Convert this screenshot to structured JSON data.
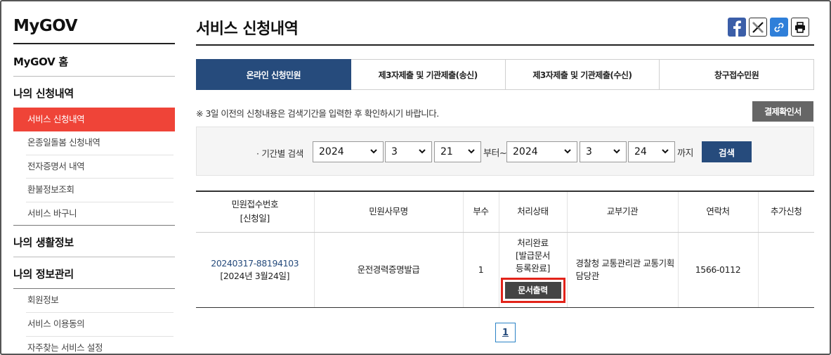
{
  "sidebar": {
    "brand": "MyGOV",
    "home": "MyGOV 홈",
    "section1": "나의 신청내역",
    "section1_items": [
      "서비스 신청내역",
      "온종일돌봄 신청내역",
      "전자증명서 내역",
      "환불정보조회",
      "서비스 바구니"
    ],
    "section2": "나의 생활정보",
    "section3": "나의 정보관리",
    "section3_items": [
      "회원정보",
      "서비스 이용동의",
      "자주찾는 서비스 설정"
    ]
  },
  "page": {
    "title": "서비스 신청내역"
  },
  "tabs": [
    "온라인 신청민원",
    "제3자제출 및 기관제출(송신)",
    "제3자제출 및 기관제출(수신)",
    "창구접수민원"
  ],
  "notice": "※ 3일 이전의 신청내용은 검색기간을 입력한 후 확인하시기 바랍니다.",
  "receipt_button": "결제확인서",
  "search": {
    "label": "기간별 검색",
    "from_year": "2024",
    "from_month": "3",
    "from_day": "21",
    "from_suffix": "부터~",
    "to_year": "2024",
    "to_month": "3",
    "to_day": "24",
    "to_suffix": "까지",
    "button": "검색"
  },
  "table": {
    "headers": [
      "민원접수번호",
      "[신청일]",
      "민원사무명",
      "부수",
      "처리상태",
      "교부기관",
      "연락처",
      "추가신청"
    ],
    "row": {
      "receipt_no": "20240317-88194103",
      "apply_date": "[2024년 3월24일]",
      "service_name": "운전경력증명발급",
      "copies": "1",
      "status_1": "처리완료",
      "status_2": "[발급문서",
      "status_3": "등록완료]",
      "print_button": "문서출력",
      "agency": "경찰청 교통관리관 교통기획담당관",
      "contact": "1566-0112",
      "extra": ""
    }
  },
  "pagination": {
    "current": "1"
  },
  "colors": {
    "navy": "#264b7c",
    "red": "#ef4438",
    "highlight": "#e2231a"
  },
  "icons": [
    "facebook-icon",
    "x-icon",
    "link-icon",
    "print-icon",
    "chevron-down-icon"
  ]
}
